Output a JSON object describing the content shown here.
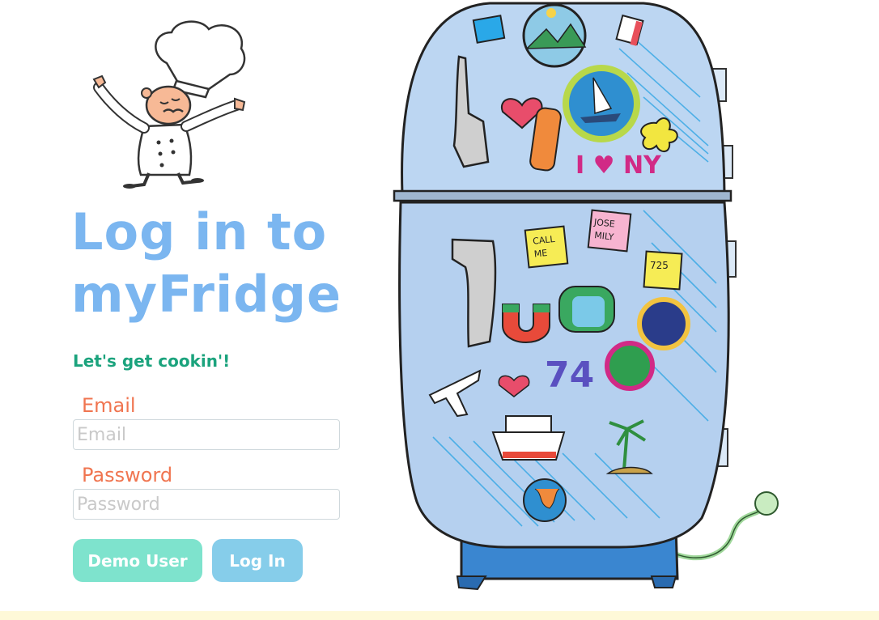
{
  "page": {
    "title_line1": "Log in to",
    "title_line2": "myFridge",
    "subtitle": "Let's get cookin'!"
  },
  "form": {
    "email": {
      "label": "Email",
      "placeholder": "Email",
      "value": ""
    },
    "password": {
      "label": "Password",
      "placeholder": "Password",
      "value": ""
    }
  },
  "buttons": {
    "demo_label": "Demo User",
    "login_label": "Log In"
  },
  "illustration": {
    "chef_icon": "chef-illustration",
    "fridge_icon": "fridge-illustration",
    "magnets": {
      "call_me_note": "CALL ME",
      "josie_note": "JOSE MILY",
      "number_note": "725",
      "i_love_ny_magnet": "I ♥ NY",
      "number_magnet": "74"
    }
  },
  "colors": {
    "title": "#7bb6f0",
    "subtitle": "#1ba37d",
    "label": "#f07550",
    "demo_button": "#7ee3cd",
    "login_button": "#86cdea",
    "footer": "#fef9d8"
  }
}
